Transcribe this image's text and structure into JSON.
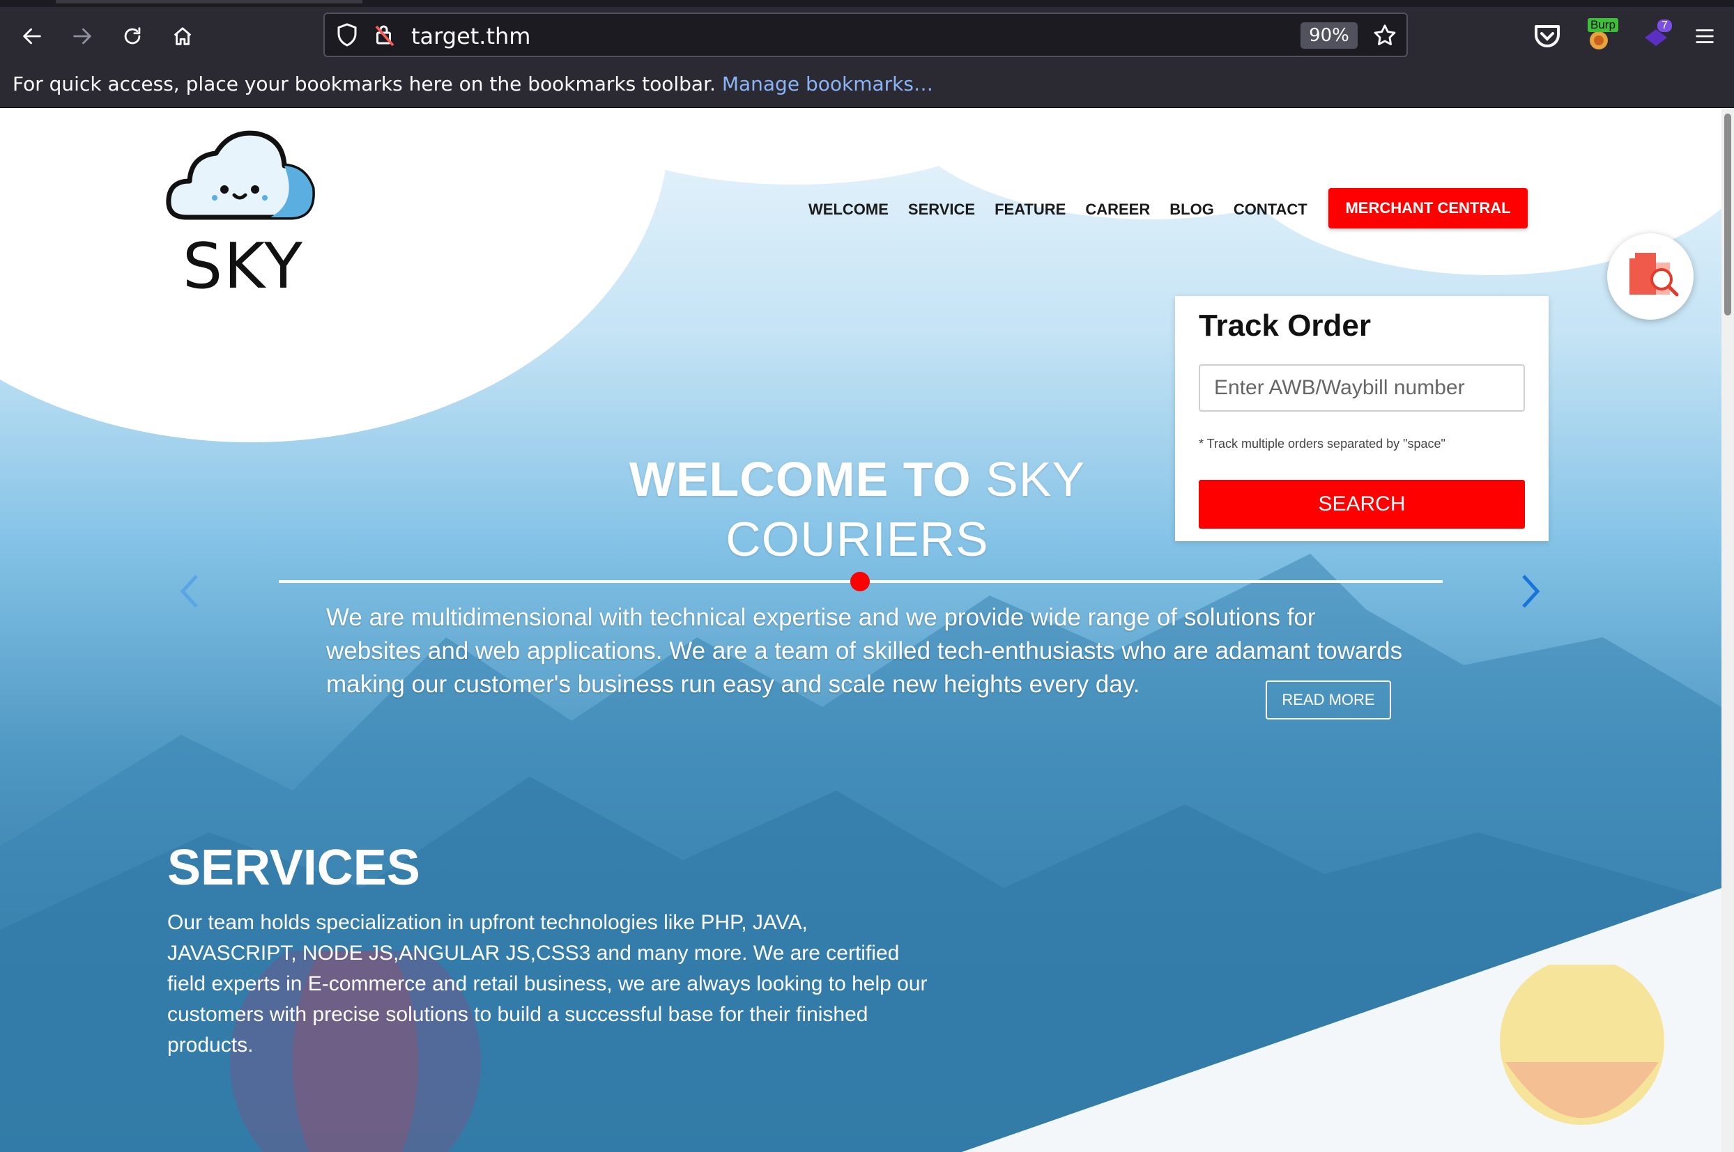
{
  "browser": {
    "url": "target.thm",
    "zoom": "90%",
    "bookmarks_message": "For quick access, place your bookmarks here on the bookmarks toolbar.",
    "manage_bookmarks_link": "Manage bookmarks…",
    "burp_badge": "Burp",
    "extension_count": "7"
  },
  "site": {
    "logo_text": "SKY",
    "nav": [
      "WELCOME",
      "SERVICE",
      "FEATURE",
      "CAREER",
      "BLOG",
      "CONTACT"
    ],
    "merchant_button": "MERCHANT CENTRAL",
    "track_order": {
      "title": "Track Order",
      "placeholder": "Enter AWB/Waybill number",
      "hint": "* Track multiple orders separated by \"space\"",
      "search_button": "SEARCH"
    },
    "hero": {
      "title_bold": "WELCOME TO",
      "title_light_1": "SKY",
      "title_light_2": "COURIERS",
      "description": "We are multidimensional with technical expertise and we provide wide range of solutions for websites and web applications. We are a team of skilled tech-enthusiasts who are adamant towards making our customer's business run easy and scale new heights every day.",
      "read_more": "READ MORE"
    },
    "services": {
      "title": "SERVICES",
      "description": "Our team holds specialization in upfront technologies like PHP, JAVA, JAVASCRIPT, NODE JS,ANGULAR JS,CSS3 and many more. We are certified field experts in E-commerce and retail business, we are always looking to help our customers with precise solutions to build a successful base for their finished products."
    }
  },
  "colors": {
    "accent_red": "#ff0000",
    "chrome_bg": "#2b2a33",
    "link_blue": "#8ab4f8"
  }
}
